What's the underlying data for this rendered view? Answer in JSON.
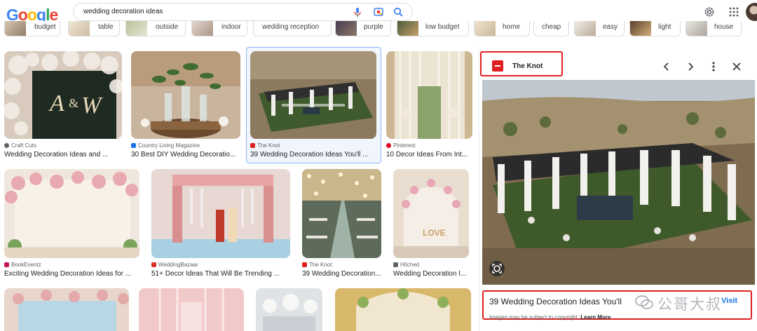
{
  "header": {
    "logo": "Google",
    "logo_letter_colors": [
      "#4285f4",
      "#ea4335",
      "#fbbc05",
      "#4285f4",
      "#34a853",
      "#ea4335"
    ],
    "search_query": "wedding decoration ideas",
    "icons": [
      "mic-icon",
      "camera-lens-icon",
      "search-icon",
      "gear-icon",
      "apps-grid-icon",
      "avatar"
    ]
  },
  "chips": [
    {
      "label": "budget"
    },
    {
      "label": "table"
    },
    {
      "label": "outside"
    },
    {
      "label": "indoor"
    },
    {
      "label": "wedding reception"
    },
    {
      "label": "purple"
    },
    {
      "label": "low budget"
    },
    {
      "label": "home"
    },
    {
      "label": "cheap"
    },
    {
      "label": "easy"
    },
    {
      "label": "light"
    },
    {
      "label": "house"
    }
  ],
  "results": [
    {
      "source": "Craft Cuts",
      "title": "Wedding Decoration Ideas and ..."
    },
    {
      "source": "Country Living Magazine",
      "title": "30 Best DIY Wedding Decoratio..."
    },
    {
      "source": "The Knot",
      "title": "39 Wedding Decoration Ideas You'll ...",
      "selected": true
    },
    {
      "source": "Pinterest",
      "title": "10 Decor Ideas From Int..."
    },
    {
      "source": "BookEventz",
      "title": "Exciting Wedding Decoration Ideas for ..."
    },
    {
      "source": "WeddingBazaar",
      "title": "51+ Decor Ideas That Will Be Trending ..."
    },
    {
      "source": "The Knot",
      "title": "39 Wedding Decoration..."
    },
    {
      "source": "Hitched",
      "title": "Wedding Decoration I..."
    }
  ],
  "preview": {
    "source": "The Knot",
    "title": "39 Wedding Decoration Ideas You'll",
    "visit_label": "Visit",
    "copyright_note": "Images may be subject to copyright.",
    "learn_more": "Learn More",
    "highlight_color": "#e02020"
  },
  "watermark": {
    "text": "公哥大叔"
  },
  "colors": {
    "accent": "#1a73e8",
    "border": "#dadce0"
  }
}
